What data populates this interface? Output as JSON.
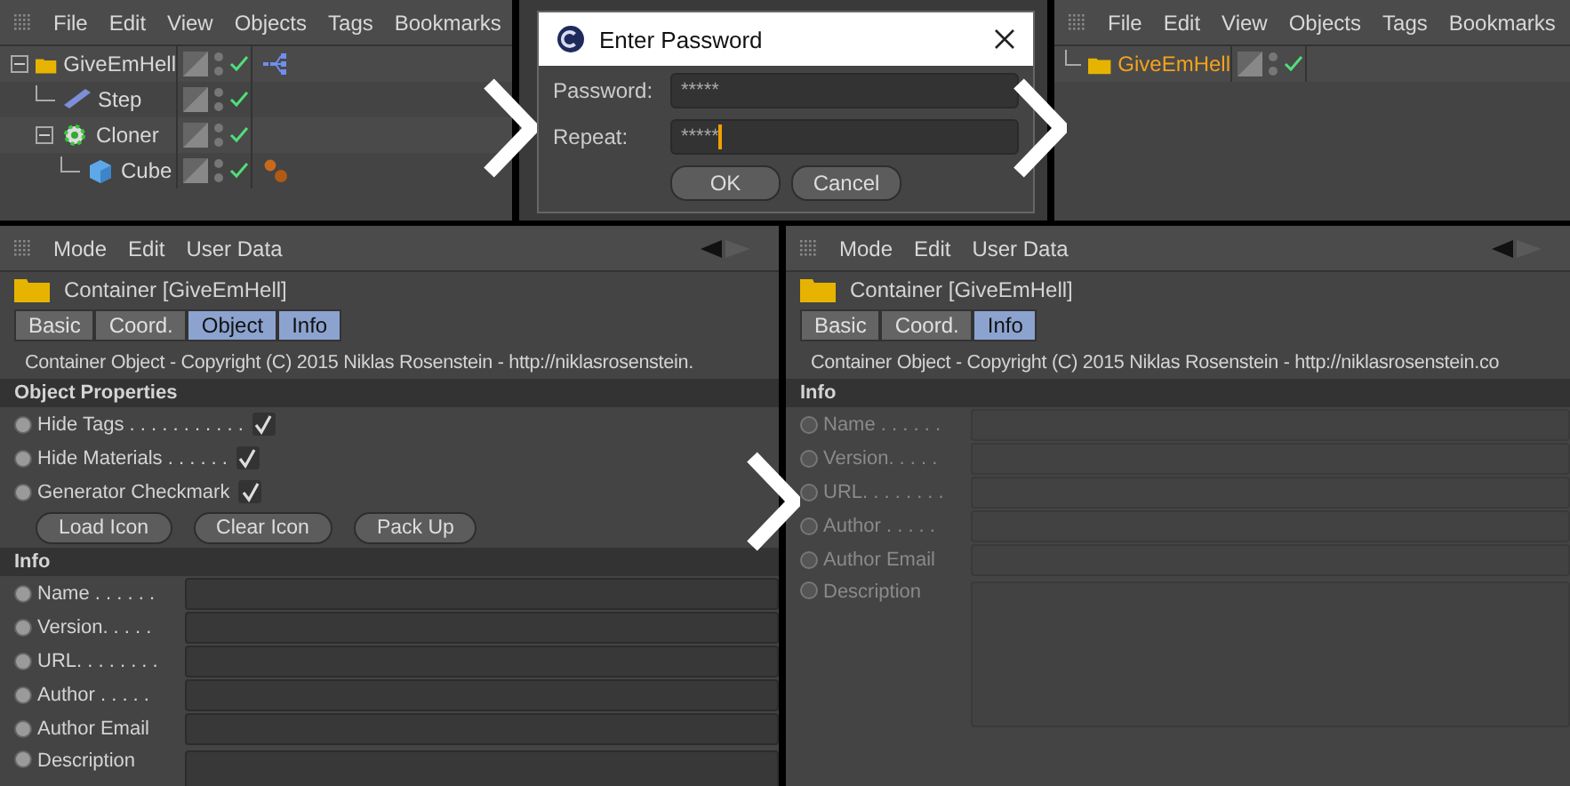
{
  "top_row": [
    {
      "kind": "object_manager",
      "menu": [
        "File",
        "Edit",
        "View",
        "Objects",
        "Tags",
        "Bookmarks"
      ],
      "objects": [
        {
          "name": "GiveEmHell",
          "kind": "folder",
          "selected": false,
          "expanded": true,
          "tags": [
            {
              "kind": "hierarchy"
            }
          ],
          "children": [
            {
              "name": "Step",
              "kind": "step",
              "selected": false
            },
            {
              "name": "Cloner",
              "kind": "cloner",
              "selected": false,
              "expanded": true,
              "children": [
                {
                  "name": "Cube",
                  "kind": "cube",
                  "selected": false,
                  "tags": [
                    {
                      "kind": "material"
                    }
                  ]
                }
              ]
            }
          ]
        }
      ]
    },
    {
      "kind": "dialog",
      "title": "Enter Password",
      "fields": [
        {
          "label": "Password:",
          "value": "*****",
          "focused": false
        },
        {
          "label": "Repeat:",
          "value": "*****",
          "focused": true
        }
      ],
      "buttons": [
        "OK",
        "Cancel"
      ]
    },
    {
      "kind": "object_manager",
      "menu": [
        "File",
        "Edit",
        "View",
        "Objects",
        "Tags",
        "Bookmarks"
      ],
      "objects": [
        {
          "name": "GiveEmHell",
          "kind": "folder",
          "selected": true
        }
      ]
    }
  ],
  "bottom_row": [
    {
      "kind": "attributes",
      "menu": [
        "Mode",
        "Edit",
        "User Data"
      ],
      "title": "Container [GiveEmHell]",
      "tabs": [
        {
          "label": "Basic",
          "selected": false
        },
        {
          "label": "Coord.",
          "selected": false
        },
        {
          "label": "Object",
          "selected": true
        },
        {
          "label": "Info",
          "selected": true
        }
      ],
      "description": "Container Object - Copyright (C) 2015 Niklas Rosenstein - http://niklasrosenstein.",
      "sections": [
        {
          "title": "Object Properties",
          "rows": [
            {
              "kind": "checkbox",
              "label": "Hide Tags . . . . . . . . . . .",
              "checked": true
            },
            {
              "kind": "checkbox",
              "label": "Hide Materials . . . . . .",
              "checked": true
            },
            {
              "kind": "checkbox",
              "label": "Generator Checkmark",
              "checked": true
            }
          ],
          "buttons": [
            "Load Icon",
            "Clear Icon",
            "Pack Up"
          ]
        },
        {
          "title": "Info",
          "rows": [
            {
              "kind": "field",
              "label": "Name . . . . . .",
              "disabled": false
            },
            {
              "kind": "field",
              "label": "Version. . . . .",
              "disabled": false
            },
            {
              "kind": "field",
              "label": "URL. . . . . . . .",
              "disabled": false
            },
            {
              "kind": "field",
              "label": "Author . . . . .",
              "disabled": false
            },
            {
              "kind": "field",
              "label": "Author Email",
              "disabled": false
            },
            {
              "kind": "textarea",
              "label": "Description",
              "disabled": false
            }
          ]
        }
      ]
    },
    {
      "kind": "attributes",
      "menu": [
        "Mode",
        "Edit",
        "User Data"
      ],
      "title": "Container [GiveEmHell]",
      "tabs": [
        {
          "label": "Basic",
          "selected": false
        },
        {
          "label": "Coord.",
          "selected": false
        },
        {
          "label": "Info",
          "selected": true
        }
      ],
      "description": "Container Object - Copyright (C) 2015 Niklas Rosenstein - http://niklasrosenstein.co",
      "sections": [
        {
          "title": "Info",
          "rows": [
            {
              "kind": "field",
              "label": "Name . . . . . .",
              "disabled": true
            },
            {
              "kind": "field",
              "label": "Version. . . . .",
              "disabled": true
            },
            {
              "kind": "field",
              "label": "URL. . . . . . . .",
              "disabled": true
            },
            {
              "kind": "field",
              "label": "Author . . . . .",
              "disabled": true
            },
            {
              "kind": "field",
              "label": "Author Email",
              "disabled": true
            },
            {
              "kind": "textarea",
              "label": "Description",
              "disabled": true
            }
          ]
        }
      ]
    }
  ]
}
